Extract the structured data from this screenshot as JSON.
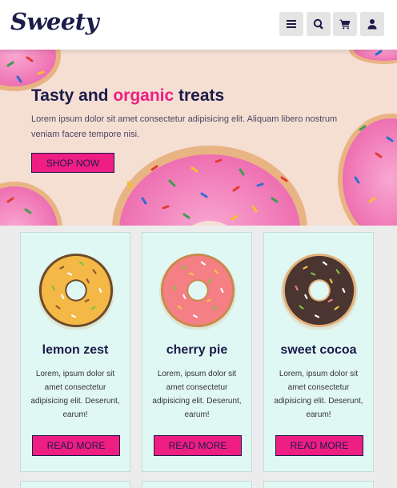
{
  "header": {
    "logo": "Sweety",
    "nav_icons": [
      "menu-icon",
      "search-icon",
      "cart-icon",
      "user-icon"
    ]
  },
  "hero": {
    "title_start": "Tasty and ",
    "title_accent": "organic",
    "title_end": " treats",
    "text": "Lorem ipsum dolor sit amet consectetur adipisicing elit. Aliquam libero nostrum veniam facere tempore nisi.",
    "button": "SHOP NOW"
  },
  "products": [
    {
      "name": "lemon zest",
      "description": "Lorem, ipsum dolor sit amet consectetur adipisicing elit. Deserunt, earum!",
      "button": "READ MORE",
      "icing_color": "#f3b846"
    },
    {
      "name": "cherry pie",
      "description": "Lorem, ipsum dolor sit amet consectetur adipisicing elit. Deserunt, earum!",
      "button": "READ MORE",
      "icing_color": "#f47f85"
    },
    {
      "name": "sweet cocoa",
      "description": "Lorem, ipsum dolor sit amet consectetur adipisicing elit. Deserunt, earum!",
      "button": "READ MORE",
      "icing_color": "#4a3530"
    }
  ],
  "colors": {
    "brand_dark": "#1c1b4a",
    "accent": "#ee1e82",
    "card_bg": "#e0f8f3",
    "hero_bg": "#f5dfd3"
  }
}
